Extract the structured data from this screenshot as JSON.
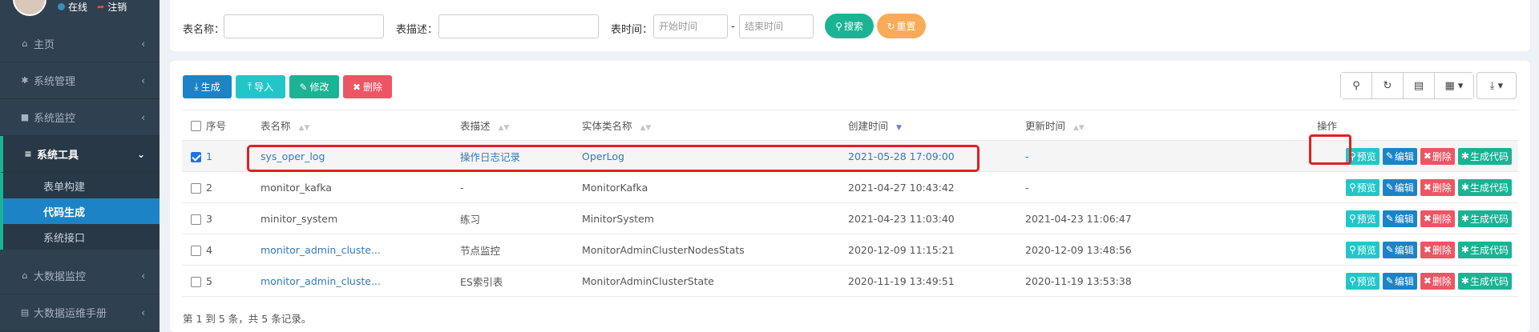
{
  "sidebar": {
    "user": {
      "status": "在线",
      "logout": "注销"
    },
    "items": [
      {
        "label": "主页",
        "icon": "home-icon"
      },
      {
        "label": "系统管理",
        "icon": "gear-icon"
      },
      {
        "label": "系统监控",
        "icon": "video-icon"
      },
      {
        "label": "系统工具",
        "icon": "bars-icon",
        "active": true
      },
      {
        "label": "大数据监控",
        "icon": "bank-icon"
      },
      {
        "label": "大数据运维手册",
        "icon": "book-icon"
      }
    ],
    "submenu": [
      "表单构建",
      "代码生成",
      "系统接口"
    ]
  },
  "search": {
    "table_name_label": "表名称：",
    "table_desc_label": "表描述：",
    "time_label": "表时间：",
    "start_placeholder": "开始时间",
    "dash": "-",
    "end_placeholder": "结束时间",
    "search_btn": "搜索",
    "reset_btn": "重置"
  },
  "toolbar": {
    "generate": "生成",
    "import": "导入",
    "edit": "修改",
    "delete": "删除"
  },
  "table": {
    "headers": {
      "index": "序号",
      "table_name": "表名称",
      "table_desc": "表描述",
      "entity": "实体类名称",
      "created": "创建时间",
      "updated": "更新时间",
      "ops": "操作"
    },
    "rows": [
      {
        "index": "1",
        "table_name": "sys_oper_log",
        "table_desc": "操作日志记录",
        "entity": "OperLog",
        "created": "2021-05-28 17:09:00",
        "updated": "-",
        "checked": true
      },
      {
        "index": "2",
        "table_name": "monitor_kafka",
        "table_desc": "-",
        "entity": "MonitorKafka",
        "created": "2021-04-27 10:43:42",
        "updated": "-",
        "checked": false
      },
      {
        "index": "3",
        "table_name": "minitor_system",
        "table_desc": "练习",
        "entity": "MinitorSystem",
        "created": "2021-04-23 11:03:40",
        "updated": "2021-04-23 11:06:47",
        "checked": false
      },
      {
        "index": "4",
        "table_name": "monitor_admin_cluste...",
        "table_desc": "节点监控",
        "entity": "MonitorAdminClusterNodesStats",
        "created": "2020-12-09 11:15:21",
        "updated": "2020-12-09 13:48:56",
        "checked": false
      },
      {
        "index": "5",
        "table_name": "monitor_admin_cluste...",
        "table_desc": "ES索引表",
        "entity": "MonitorAdminClusterState",
        "created": "2020-11-19 13:49:51",
        "updated": "2020-11-19 13:53:38",
        "checked": false
      }
    ],
    "row_actions": {
      "preview": "预览",
      "edit": "编辑",
      "delete": "删除",
      "gen": "生成代码"
    }
  },
  "pagination": {
    "info": "第 1 到 5 条，共 5 条记录。"
  },
  "colors": {
    "sidebar_bg": "#2f4050",
    "primary": "#1c84c6",
    "success": "#1ab394",
    "danger": "#ed5565",
    "info": "#23c6c8",
    "warning": "#f8ac59",
    "highlight": "#e02020"
  }
}
